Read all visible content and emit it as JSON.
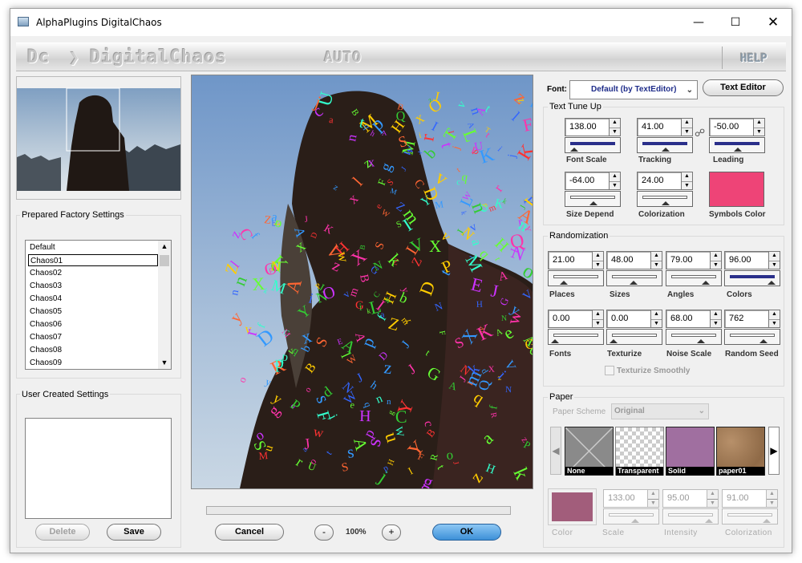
{
  "window": {
    "title": "AlphaPlugins DigitalChaos"
  },
  "banner": {
    "logo": "Dc",
    "product": "DigitalChaos",
    "mode": "AUTO",
    "help": "HELP"
  },
  "left": {
    "prepared_title": "Prepared Factory Settings",
    "presets": [
      "Default",
      "Chaos01",
      "Chaos02",
      "Chaos03",
      "Chaos04",
      "Chaos05",
      "Chaos06",
      "Chaos07",
      "Chaos08",
      "Chaos09"
    ],
    "selected_preset": "Chaos01",
    "user_title": "User Created Settings",
    "delete_label": "Delete",
    "save_label": "Save"
  },
  "bottom": {
    "cancel_label": "Cancel",
    "zoom_out": "-",
    "zoom": "100%",
    "zoom_in": "+",
    "ok_label": "OK"
  },
  "font": {
    "label": "Font:",
    "value": "Default (by TextEditor)",
    "editor_label": "Text Editor"
  },
  "text_tune": {
    "title": "Text Tune Up",
    "font_scale": {
      "value": "138.00",
      "label": "Font Scale",
      "level": 0.05
    },
    "tracking": {
      "value": "41.00",
      "label": "Tracking",
      "level": 0.05
    },
    "leading": {
      "value": "-50.00",
      "label": "Leading",
      "level": 0.05
    },
    "size_depend": {
      "value": "-64.00",
      "label": "Size Depend",
      "level": 0.05
    },
    "colorization": {
      "value": "24.00",
      "label": "Colorization",
      "level": 0.05
    },
    "symbols_color": {
      "label": "Symbols Color",
      "color": "#ee4477"
    }
  },
  "randomization": {
    "title": "Randomization",
    "places": {
      "value": "21.00",
      "label": "Places",
      "level": 0.21
    },
    "sizes": {
      "value": "48.00",
      "label": "Sizes",
      "level": 0.48
    },
    "angles": {
      "value": "79.00",
      "label": "Angles",
      "level": 0.79
    },
    "colors": {
      "value": "96.00",
      "label": "Colors",
      "level": 0.96
    },
    "fonts": {
      "value": "0.00",
      "label": "Fonts",
      "level": 0.0
    },
    "texturize": {
      "value": "0.00",
      "label": "Texturize",
      "level": 0.0
    },
    "noise_scale": {
      "value": "68.00",
      "label": "Noise Scale",
      "level": 0.68
    },
    "random_seed": {
      "value": "762",
      "label": "Random Seed",
      "level": 0.76
    },
    "texturize_smoothly": {
      "label": "Texturize Smoothly",
      "checked": false
    }
  },
  "paper": {
    "title": "Paper",
    "scheme_label": "Paper Scheme",
    "scheme_value": "Original",
    "tiles": [
      "None",
      "Transparent",
      "Solid",
      "paper01"
    ],
    "color_label": "Color",
    "swatch_color": "#a25d7b",
    "scale": {
      "value": "133.00",
      "label": "Scale",
      "level": 0.6
    },
    "intensity": {
      "value": "95.00",
      "label": "Intensity",
      "level": 0.95
    },
    "colorization": {
      "value": "91.00",
      "label": "Colorization",
      "level": 0.91
    }
  }
}
